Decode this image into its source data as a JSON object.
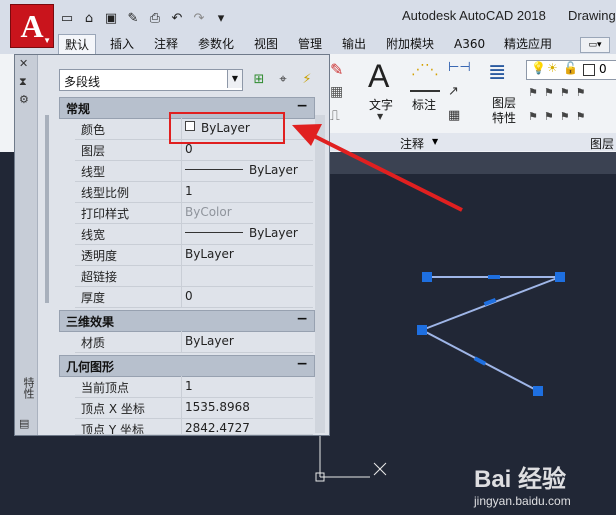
{
  "window": {
    "app_title": "Autodesk AutoCAD 2018",
    "drawing_name": "Drawing"
  },
  "app_menu": {
    "logo_letter": "A"
  },
  "ribbon": {
    "tabs": [
      "默认",
      "插入",
      "注释",
      "参数化",
      "视图",
      "管理",
      "输出",
      "附加模块",
      "A360",
      "精选应用"
    ],
    "active_tab": "默认",
    "groups": {
      "text_label": "文字",
      "dim_label": "标注",
      "annotation_panel": "注释",
      "layer_props_label": "图层\n特性",
      "layer_panel": "图层"
    }
  },
  "properties": {
    "vertical_label": "特性",
    "object_type": "多段线",
    "sections": {
      "general": {
        "title": "常规",
        "rows": [
          {
            "key": "颜色",
            "value": "ByLayer"
          },
          {
            "key": "图层",
            "value": "0"
          },
          {
            "key": "线型",
            "value": "ByLayer"
          },
          {
            "key": "线型比例",
            "value": "1"
          },
          {
            "key": "打印样式",
            "value": "ByColor"
          },
          {
            "key": "线宽",
            "value": "ByLayer"
          },
          {
            "key": "透明度",
            "value": "ByLayer"
          },
          {
            "key": "超链接",
            "value": ""
          },
          {
            "key": "厚度",
            "value": "0"
          }
        ]
      },
      "3d": {
        "title": "三维效果",
        "rows": [
          {
            "key": "材质",
            "value": "ByLayer"
          }
        ]
      },
      "geometry": {
        "title": "几何图形",
        "rows": [
          {
            "key": "当前顶点",
            "value": "1"
          },
          {
            "key": "顶点 X 坐标",
            "value": "1535.8968"
          },
          {
            "key": "顶点 Y 坐标",
            "value": "2842.4727"
          }
        ]
      }
    }
  },
  "watermark": {
    "brand": "Bai 经验",
    "url": "jingyan.baidu.com"
  }
}
